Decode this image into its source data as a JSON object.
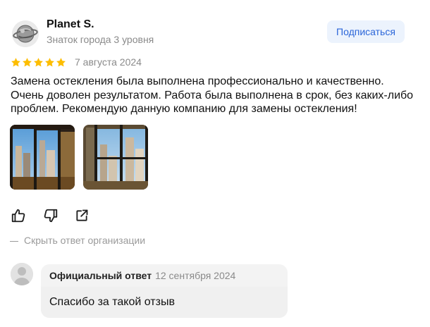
{
  "author": {
    "name": "Planet S.",
    "level": "Знаток города 3 уровня",
    "avatar_icon": "planet-logo-icon"
  },
  "subscribe_label": "Подписаться",
  "review": {
    "rating": 5,
    "max_rating": 5,
    "star_color": "#fdbd00",
    "date": "7 августа 2024",
    "text": "Замена остекления была выполнена профессионально и качественно. Очень доволен результатом. Работа была выполнена в срок, без каких-либо проблем. Рекомендую данную компанию для замены остекления!",
    "photos": [
      "balcony-window-photo",
      "balcony-window-photo"
    ]
  },
  "actions": {
    "like_icon": "thumbs-up-icon",
    "dislike_icon": "thumbs-down-icon",
    "share_icon": "share-icon"
  },
  "toggle_answer_label": "Скрыть ответ организации",
  "org_answer": {
    "label": "Официальный ответ",
    "date": "12 сентября 2024",
    "text": "Спасибо за такой отзыв",
    "avatar_icon": "user-placeholder-icon"
  },
  "colors": {
    "accent": "#2b66d9",
    "subscribe_bg": "#ecf3fd",
    "muted": "#8a8a8a"
  }
}
